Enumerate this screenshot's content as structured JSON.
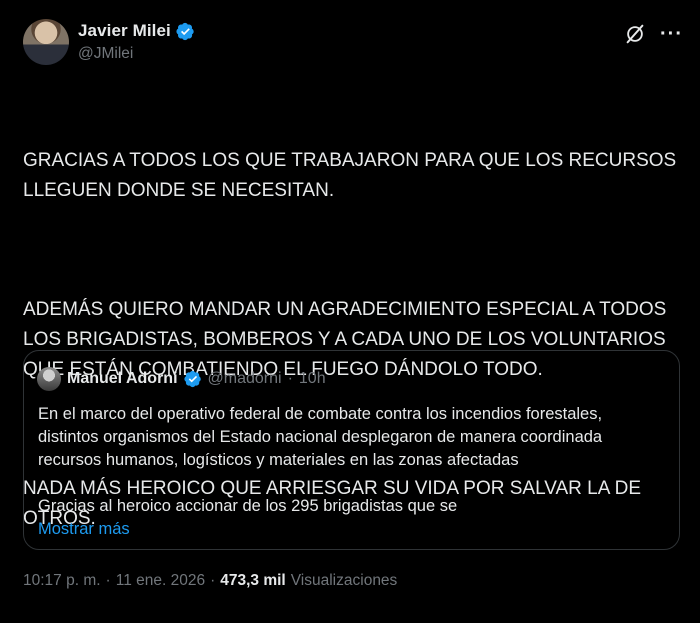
{
  "author": {
    "name": "Javier Milei",
    "handle": "@JMilei"
  },
  "post": {
    "paragraphs": [
      "GRACIAS A TODOS LOS QUE TRABAJARON PARA QUE LOS RECURSOS\nLLEGUEN DONDE SE NECESITAN.",
      "ADEMÁS QUIERO MANDAR UN AGRADECIMIENTO ESPECIAL A TODOS\nLOS BRIGADISTAS, BOMBEROS Y A CADA UNO DE LOS VOLUNTARIOS\nQUE ESTÁN COMBATIENDO EL FUEGO DÁNDOLO TODO.",
      "NADA MÁS HEROICO QUE ARRIESGAR SU VIDA POR SALVAR LA DE\nOTROS."
    ]
  },
  "quote": {
    "name": "Manuel Adorni",
    "handle": "@madorni",
    "separator": "·",
    "time": "10h",
    "text_1": "En el marco del operativo federal de combate contra los incendios forestales,\ndistintos organismos del Estado nacional desplegaron de manera coordinada\nrecursos humanos, logísticos y materiales en las zonas afectadas",
    "text_2": "Gracias al heroico accionar de los 295 brigadistas que se",
    "show_more": "Mostrar más"
  },
  "meta": {
    "time": "10:17 p. m.",
    "separator_1": "·",
    "date": "11 ene. 2026",
    "separator_2": "·",
    "views_count": "473,3 mil",
    "views_label": "Visualizaciones"
  },
  "colors": {
    "background": "#000000",
    "text": "#e7e9ea",
    "muted": "#71767b",
    "link": "#1d9bf0",
    "verified": "#1d9bf0",
    "border": "#2f3336"
  },
  "icons": [
    "verified-badge-icon",
    "grok-icon",
    "more-options-icon"
  ]
}
